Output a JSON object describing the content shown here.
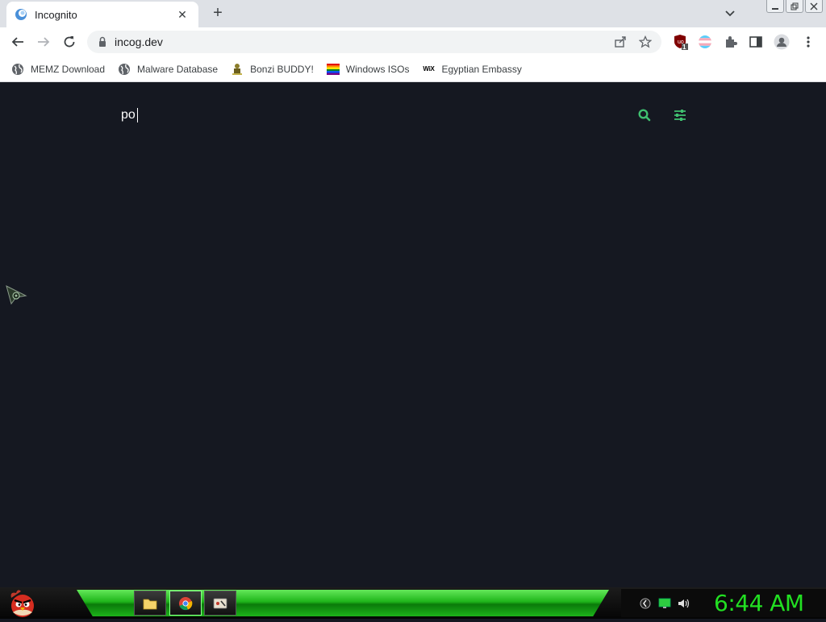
{
  "browser": {
    "tab_title": "Incognito",
    "tab_close": "✕",
    "new_tab": "+",
    "url": "incog.dev",
    "extension_badge": "1"
  },
  "bookmarks": [
    {
      "label": "MEMZ Download",
      "icon": "globe-icon"
    },
    {
      "label": "Malware Database",
      "icon": "globe-icon"
    },
    {
      "label": "Bonzi BUDDY!",
      "icon": "bonzi-icon"
    },
    {
      "label": "Windows ISOs",
      "icon": "rainbow-flag-icon"
    },
    {
      "label": "Egyptian Embassy",
      "icon": "wix-icon"
    }
  ],
  "bookmark_wix_text": "WiX",
  "page": {
    "search_value": "po",
    "accent_color": "#3fbf6f"
  },
  "taskbar": {
    "clock": "6:44 AM"
  },
  "colors": {
    "page_bg": "#151821",
    "clock": "#22e022"
  }
}
